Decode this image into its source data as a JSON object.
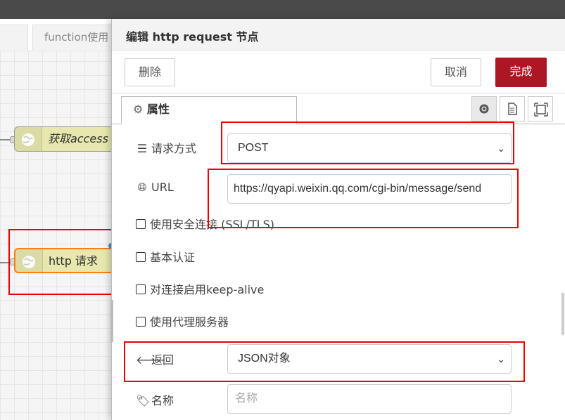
{
  "workspace": {
    "tabs": [
      {
        "label": ""
      },
      {
        "label": "function使用"
      }
    ],
    "nodes": [
      {
        "label": "获取access"
      },
      {
        "label": "http 请求"
      }
    ]
  },
  "tray": {
    "title": "编辑 http request 节点",
    "buttons": {
      "delete": "删除",
      "cancel": "取消",
      "done": "完成"
    },
    "tab": {
      "label": "属性"
    },
    "fields": {
      "method": {
        "label": "请求方式",
        "value": "POST"
      },
      "url": {
        "label": "URL",
        "value": "https://qyapi.weixin.qq.com/cgi-bin/message/send"
      },
      "tls": {
        "label": "使用安全连接 (SSL/TLS)",
        "checked": false
      },
      "auth": {
        "label": "基本认证",
        "checked": false
      },
      "keepalive": {
        "label": "对连接启用keep-alive",
        "checked": false
      },
      "proxy": {
        "label": "使用代理服务器",
        "checked": false
      },
      "ret": {
        "label": "返回",
        "value": "JSON对象"
      },
      "name": {
        "label": "名称",
        "placeholder": "名称"
      }
    }
  },
  "colors": {
    "accent": "#ad1625",
    "annotation": "#e00000",
    "node_fill": "#e7e7ae"
  },
  "icons": [
    "gear-icon",
    "file-icon",
    "frame-icon",
    "list-icon",
    "globe-icon",
    "arrow-left-icon",
    "tag-icon",
    "chevron-down-icon"
  ]
}
